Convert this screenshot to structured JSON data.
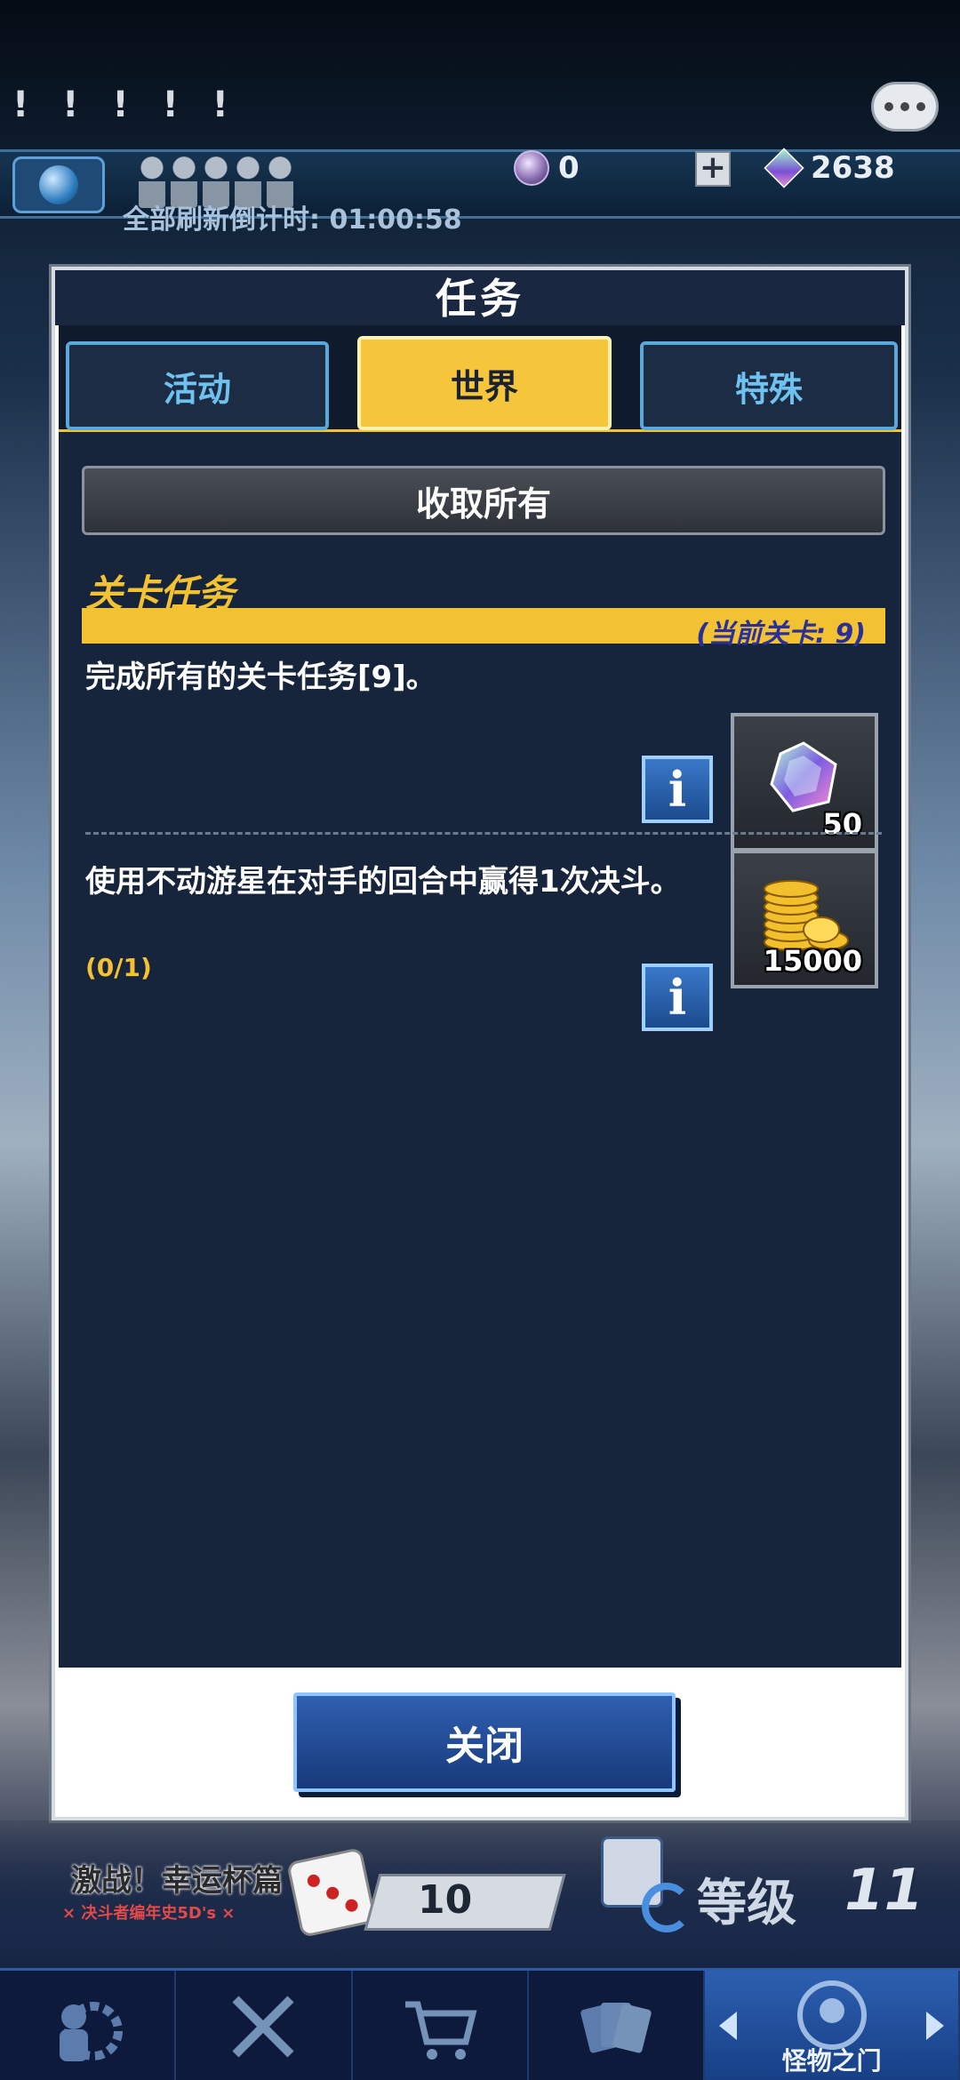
{
  "hud": {
    "alerts": "! ! ! ! !",
    "currency_orb": "0",
    "currency_gems": "2638",
    "refresh_countdown": "全部刷新倒计时: 01:00:58"
  },
  "modal": {
    "title": "任务",
    "tabs": [
      {
        "label": "活动",
        "active": false
      },
      {
        "label": "世界",
        "active": true
      },
      {
        "label": "特殊",
        "active": false
      }
    ],
    "collect_all": "收取所有",
    "section": {
      "title": "关卡任务",
      "current_stage": "(当前关卡: 9)"
    },
    "missions": [
      {
        "text": "完成所有的关卡任务[9]。",
        "progress": "",
        "reward_icon": "gem-icon",
        "reward_qty": "50"
      },
      {
        "text": "使用不动游星在对手的回合中赢得1次决斗。",
        "progress": "(0/1)",
        "reward_icon": "gold-coins-icon",
        "reward_qty": "15000"
      }
    ],
    "info_glyph": "i",
    "close": "关闭"
  },
  "bottom": {
    "event_title": "激战！幸运杯篇",
    "event_subtitle": "× 决斗者编年史5D's ×",
    "dice_count": "10",
    "level_label": "等级",
    "level_value": "11"
  },
  "nav": [
    {
      "icon": "duelist-gear-icon",
      "label": ""
    },
    {
      "icon": "crossed-swords-icon",
      "label": ""
    },
    {
      "icon": "shopping-cart-icon",
      "label": ""
    },
    {
      "icon": "cards-icon",
      "label": ""
    },
    {
      "icon": "monster-gate-icon",
      "label": "怪物之门"
    }
  ],
  "colors": {
    "accent_yellow": "#f2c233",
    "tab_blue": "#58a9d8",
    "stage_text": "#2a2f9a",
    "panel": "#16243c"
  }
}
